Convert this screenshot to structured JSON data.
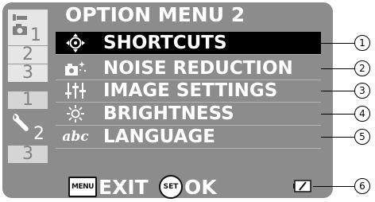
{
  "menu": {
    "title": "OPTION MENU 2",
    "items": [
      {
        "label": "SHORTCUTS",
        "icon": "target-icon",
        "selected": true
      },
      {
        "label": "NOISE REDUCTION",
        "icon": "noise-reduction-icon",
        "selected": false
      },
      {
        "label": "IMAGE SETTINGS",
        "icon": "image-settings-icon",
        "selected": false
      },
      {
        "label": "BRIGHTNESS",
        "icon": "brightness-icon",
        "selected": false
      },
      {
        "label": "LANGUAGE",
        "icon": "language-icon",
        "icon_text": "abc",
        "selected": false
      }
    ]
  },
  "tabs": {
    "camera_group": [
      "1",
      "2",
      "3"
    ],
    "setup_group": [
      "1",
      "2",
      "3"
    ],
    "active": "setup-2"
  },
  "footer": {
    "menu_key": "MENU",
    "exit_label": "EXIT",
    "set_key": "SET",
    "ok_label": "OK"
  },
  "callouts": [
    "1",
    "2",
    "3",
    "4",
    "5",
    "6"
  ],
  "colors": {
    "panel": "#8c8c8c",
    "selected_row": "#000000",
    "text": "#ffffff",
    "tab_inactive": "#e6e6e6"
  }
}
